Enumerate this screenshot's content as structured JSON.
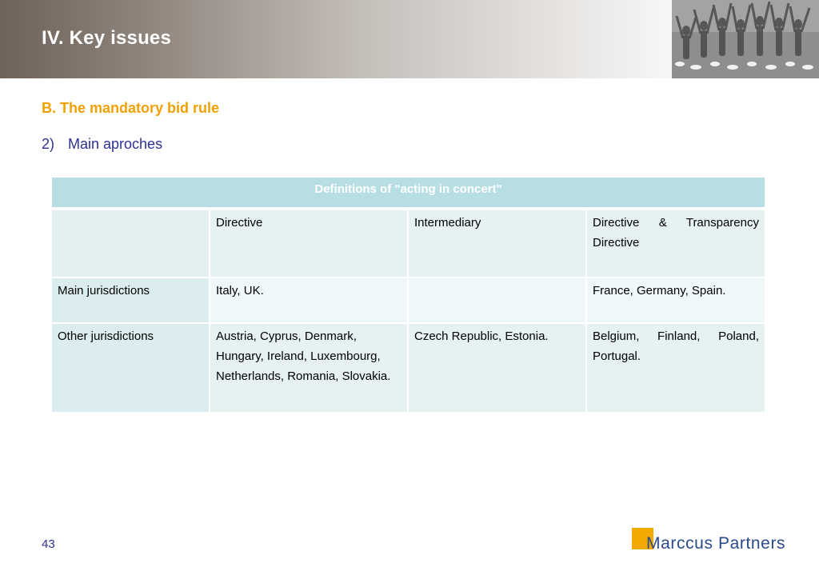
{
  "slide": {
    "title": "IV.  Key issues",
    "section": "B.  The mandatory bid rule",
    "sub_number": "2)",
    "sub_title": "Main aproches",
    "page_number": "43",
    "logo_text": "Marccus Partners"
  },
  "table": {
    "caption": "Definitions of \"acting in concert\"",
    "header_row": [
      "",
      "Directive",
      "Intermediary",
      "Directive & Transparency Directive"
    ],
    "rows": [
      {
        "label": "Main jurisdictions",
        "cells": [
          "Italy, UK.",
          "",
          "France, Germany, Spain."
        ]
      },
      {
        "label": "Other jurisdictions",
        "cells": [
          "Austria, Cyprus, Denmark, Hungary, Ireland, Luxembourg, Netherlands, Romania, Slovakia.",
          "Czech Republic, Estonia.",
          "Belgium, Finland, Poland, Portugal."
        ]
      }
    ]
  },
  "colors": {
    "section_heading": "#f0a000",
    "subheading": "#2e3192",
    "table_caption_bg": "#b7dfe3",
    "logo_square": "#f2a900",
    "logo_text": "#2b4a8a"
  },
  "icons": {
    "header_photo": "people-holding-hands-photo",
    "logo_mark": "orange-square-logo-mark"
  }
}
